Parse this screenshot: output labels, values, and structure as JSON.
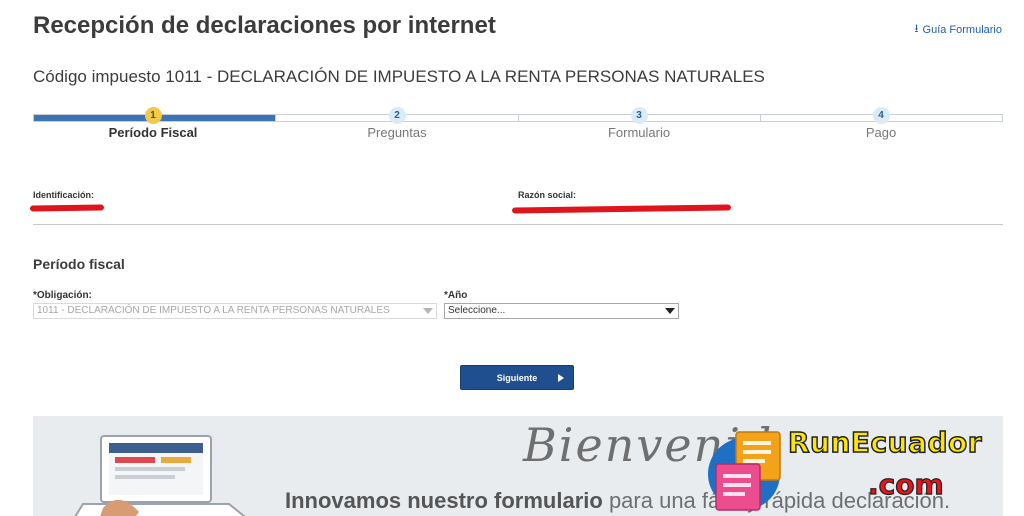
{
  "header": {
    "title": "Recepción de declaraciones por internet",
    "guide_link": "Guía Formulario"
  },
  "subtitle": "Código impuesto 1011 - DECLARACIÓN DE IMPUESTO A LA RENTA PERSONAS NATURALES",
  "stepper": {
    "current_step": 1,
    "steps": [
      {
        "number": "1",
        "label": "Período Fiscal"
      },
      {
        "number": "2",
        "label": "Preguntas"
      },
      {
        "number": "3",
        "label": "Formulario"
      },
      {
        "number": "4",
        "label": "Pago"
      }
    ]
  },
  "taxpayer": {
    "identification_label": "Identificación:",
    "business_name_label": "Razón social:"
  },
  "form": {
    "section_title": "Período fiscal",
    "obligation_label": "*Obligación:",
    "obligation_value": "1011 - DECLARACIÓN DE IMPUESTO A LA RENTA PERSONAS NATURALES",
    "year_label": "*Año",
    "year_value": "Seleccione..."
  },
  "next_button": "Siguiente",
  "banner": {
    "welcome": "Bienvenid",
    "tagline_bold": "Innovamos nuestro formulario",
    "tagline_rest": " para una fácil y rápida declaración."
  },
  "watermark": {
    "line1": "RunEcuador",
    "line2": ".com"
  },
  "colors": {
    "primary": "#1f4f8f",
    "progress": "#3f73b6",
    "active_step": "#f3c94a",
    "step_circle": "#d8ebf7",
    "redaction": "#e0141c",
    "banner_bg": "#e8ecef"
  }
}
